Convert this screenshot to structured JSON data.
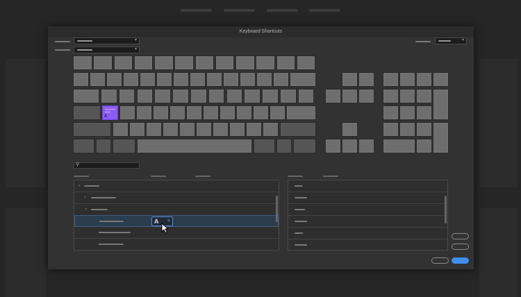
{
  "dialog": {
    "title": "Keyboard Shortcuts"
  },
  "keyboard": {
    "assigned_key_label": "A",
    "assigned_key_color": "#8b5cf6",
    "key_color": "#6e6e6e",
    "modifier_key_color": "#555555"
  },
  "commands": {
    "shortcut_chip": {
      "key": "A",
      "remove_icon": "×"
    },
    "selected_row_color": "#2c3d50"
  },
  "buttons": {
    "primary_color": "#3d8ef0"
  },
  "icons": {
    "search": "⚲",
    "chevron": "▾",
    "expand": "›",
    "collapse": "⌄",
    "cursor": "arrow-pointer"
  }
}
